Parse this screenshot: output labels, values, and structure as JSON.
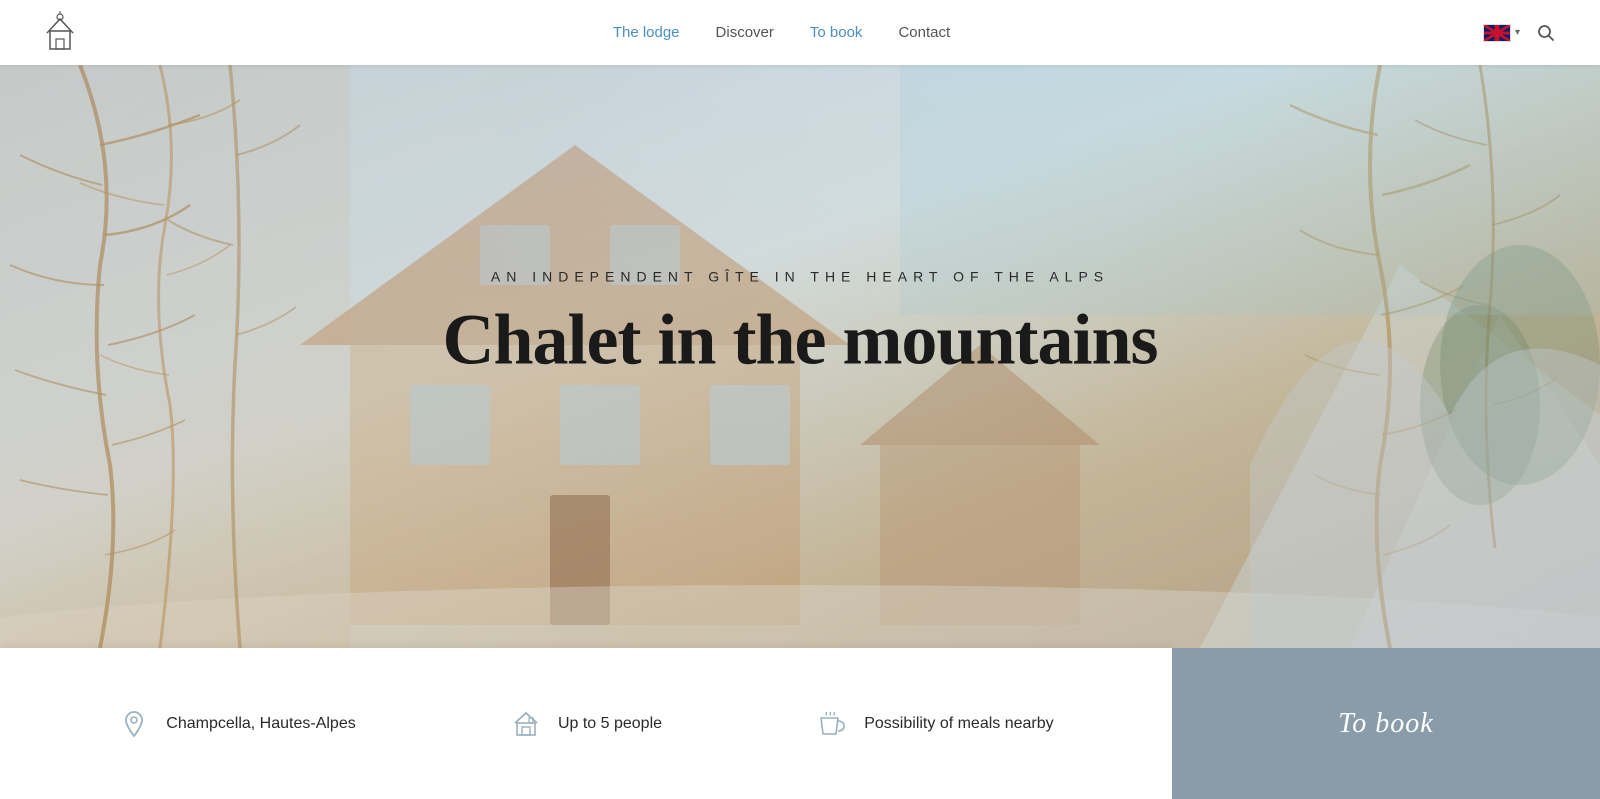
{
  "header": {
    "logo_alt": "Le Titelec Logo",
    "nav": {
      "the_lodge": "The lodge",
      "discover": "Discover",
      "to_book": "To book",
      "contact": "Contact"
    },
    "language": "EN",
    "search_placeholder": "Search"
  },
  "hero": {
    "subtitle": "AN INDEPENDENT GÎTE IN THE HEART OF THE ALPS",
    "title": "Chalet in the mountains"
  },
  "info_bar": {
    "location": "Champcella, Hautes-Alpes",
    "capacity": "Up to 5 people",
    "meals": "Possibility of meals nearby"
  },
  "to_book_panel": {
    "label": "To book"
  }
}
